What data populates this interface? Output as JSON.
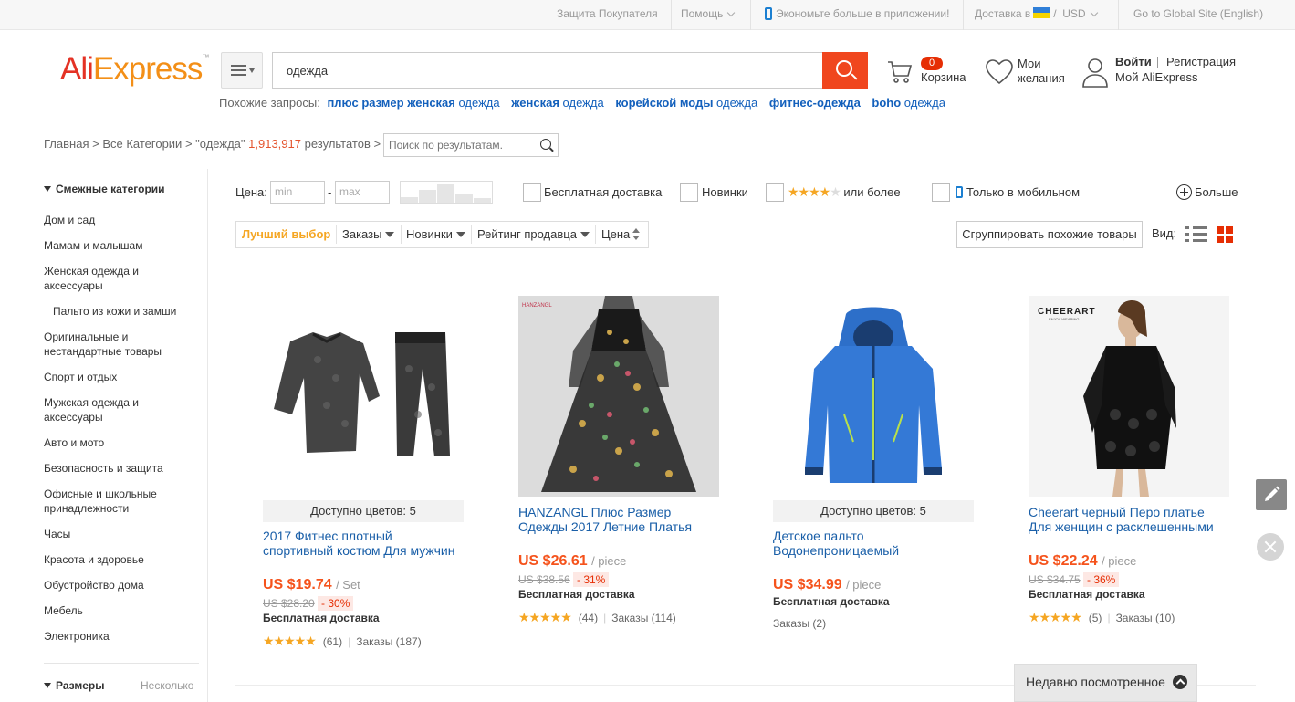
{
  "topbar": {
    "buyer_protection": "Защита Покупателя",
    "help": "Помощь",
    "app_promo": "Экономьте больше в приложении!",
    "ship_to": "Доставка в",
    "currency_sep": "/",
    "currency": "USD",
    "global_site": "Go to Global Site (English)"
  },
  "header": {
    "logo_ali": "Ali",
    "logo_express": "Express",
    "logo_tm": "™",
    "search_value": "одежда",
    "related_label": "Похожие запросы:",
    "related": [
      {
        "bold": "плюс размер женская",
        "rest": " одежда"
      },
      {
        "bold": "женская",
        "rest": " одежда"
      },
      {
        "bold": "корейской моды",
        "rest": " одежда"
      },
      {
        "bold": "фитнес-одежда",
        "rest": ""
      },
      {
        "bold": "boho",
        "rest": " одежда"
      }
    ],
    "cart_count": "0",
    "cart_label": "Корзина",
    "wishlist_label": "Мои желания",
    "login": "Войти",
    "register": "Регистрация",
    "my_account": "Мой AliExpress"
  },
  "breadcrumb": {
    "home": "Главная",
    "all_categories": "Все Категории",
    "query": "\"одежда\"",
    "count": "1,913,917",
    "results_label": "результатов",
    "search_within_placeholder": "Поиск по результатам."
  },
  "sidebar": {
    "title": "Смежные категории",
    "items": [
      {
        "label": "Дом и сад",
        "sub": false
      },
      {
        "label": "Мамам и малышам",
        "sub": false
      },
      {
        "label": "Женская одежда и аксессуары",
        "sub": false
      },
      {
        "label": "Пальто из кожи и замши",
        "sub": true
      },
      {
        "label": "Оригинальные и нестандартные товары",
        "sub": false
      },
      {
        "label": "Спорт и отдых",
        "sub": false
      },
      {
        "label": "Мужская одежда и аксессуары",
        "sub": false
      },
      {
        "label": "Авто и мото",
        "sub": false
      },
      {
        "label": "Безопасность и защита",
        "sub": false
      },
      {
        "label": "Офисные и школьные принадлежности",
        "sub": false
      },
      {
        "label": "Часы",
        "sub": false
      },
      {
        "label": "Красота и здоровье",
        "sub": false
      },
      {
        "label": "Обустройство дома",
        "sub": false
      },
      {
        "label": "Мебель",
        "sub": false
      },
      {
        "label": "Электроника",
        "sub": false
      }
    ],
    "sizes_title": "Размеры",
    "sizes_value": "Несколько"
  },
  "filters": {
    "price_label": "Цена:",
    "min_placeholder": "min",
    "dash": "-",
    "max_placeholder": "max",
    "free_shipping": "Бесплатная доставка",
    "new": "Новинки",
    "rating_suffix": "или более",
    "mobile_only": "Только в мобильном",
    "more": "Больше"
  },
  "sort": {
    "best": "Лучший выбор",
    "orders": "Заказы",
    "newest": "Новинки",
    "seller_rating": "Рейтинг продавца",
    "price": "Цена",
    "group_similar": "Сгруппировать похожие товары",
    "view_label": "Вид:"
  },
  "products": [
    {
      "colors": "Доступно цветов: 5",
      "title": "2017 Фитнес плотный спортивный костюм Для мужчин",
      "price": "US $19.74",
      "unit": "/ Set",
      "old_price": "US $28.20",
      "discount": "- 30%",
      "shipping": "Бесплатная доставка",
      "reviews": "(61)",
      "orders": "Заказы (187)"
    },
    {
      "colors": "",
      "brand": "HANZANGL",
      "title": "HANZANGL Плюс Размер Одежды 2017 Летние Платья",
      "price": "US $26.61",
      "unit": "/ piece",
      "old_price": "US $38.56",
      "discount": "- 31%",
      "shipping": "Бесплатная доставка",
      "reviews": "(44)",
      "orders": "Заказы (114)"
    },
    {
      "colors": "Доступно цветов: 5",
      "title": "Детское пальто Водонепроницаемый",
      "price": "US $34.99",
      "unit": "/ piece",
      "old_price": "",
      "discount": "",
      "shipping": "Бесплатная доставка",
      "reviews": "",
      "orders": "Заказы (2)"
    },
    {
      "colors": "",
      "brand": "CHEERART",
      "brand_sub": "ENJOY WEARING",
      "title": "Cheerart черный Перо платье Для женщин с расклешенными",
      "price": "US $22.24",
      "unit": "/ piece",
      "old_price": "US $34.75",
      "discount": "- 36%",
      "shipping": "Бесплатная доставка",
      "reviews": "(5)",
      "orders": "Заказы (10)"
    }
  ],
  "recently_viewed": "Недавно посмотренное",
  "colors": {
    "accent": "#f0461e",
    "price": "#f5531c",
    "link": "#1a5fa8",
    "star": "#f5a623"
  },
  "icons": [
    "phone-icon",
    "flag-icon",
    "menu-icon",
    "search-icon",
    "cart-icon",
    "heart-icon",
    "user-icon",
    "list-view-icon",
    "grid-view-icon",
    "edit-icon",
    "close-icon",
    "chevron-up-icon"
  ]
}
